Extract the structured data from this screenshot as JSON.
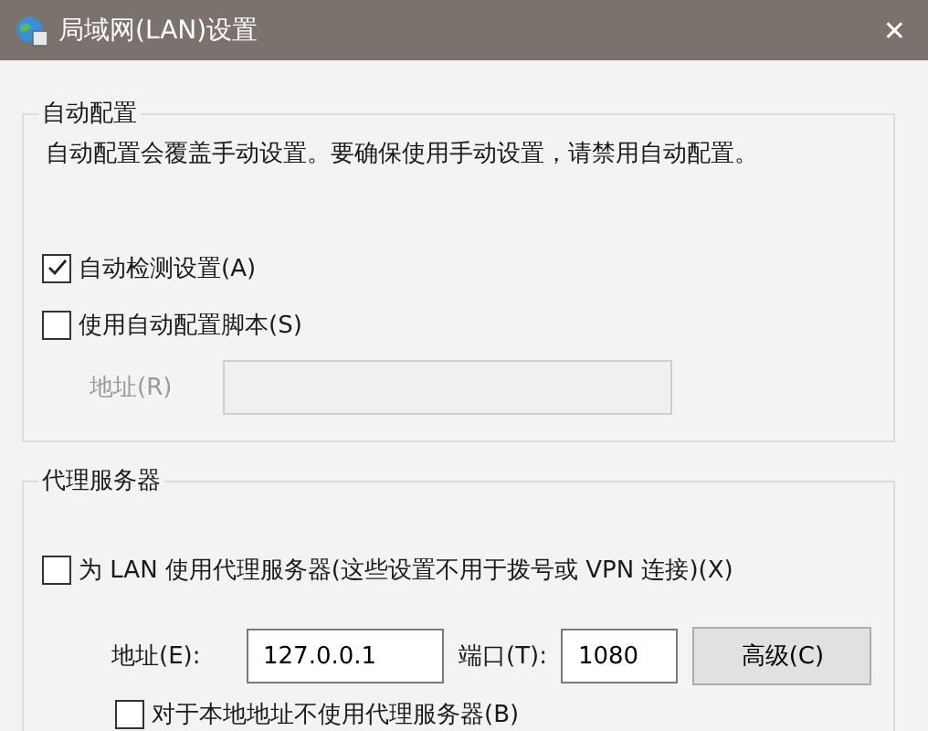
{
  "window": {
    "title": "局域网(LAN)设置",
    "close": "✕"
  },
  "auto_config": {
    "title": "自动配置",
    "description": "自动配置会覆盖手动设置。要确保使用手动设置，请禁用自动配置。",
    "checkboxes": [
      {
        "label": "自动检测设置(A)",
        "checked": true
      },
      {
        "label": "使用自动配置脚本(S)",
        "checked": false
      }
    ],
    "address": {
      "label": "地址(R)",
      "disabled": true
    }
  },
  "proxy": {
    "title": "代理服务器",
    "use_proxy": {
      "label": "为 LAN 使用代理服务器(这些设置不用于拨号或 VPN 连接)(X)",
      "checked": false
    },
    "address": {
      "label": "地址(E):",
      "value": "127.0.0.1"
    },
    "port": {
      "label": "端口(T):",
      "value": "1080"
    },
    "advanced_button": "高级(C)",
    "bypass_local": {
      "label": "对于本地地址不使用代理服务器(B)",
      "checked": false
    }
  }
}
